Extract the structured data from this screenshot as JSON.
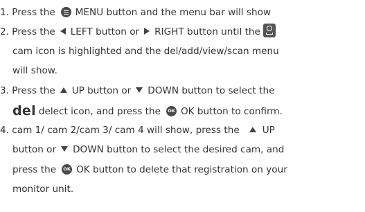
{
  "steps": [
    {
      "lines": [
        {
          "a": "1. Press the",
          "b": "MENU button and the menu bar will show"
        }
      ]
    },
    {
      "lines": [
        {
          "a": "2. Press the",
          "b": "LEFT button or",
          "c": "RIGHT button until the"
        },
        {
          "a": "cam  icon is highlighted and the del/add/view/scan menu"
        },
        {
          "a": "will show."
        }
      ]
    },
    {
      "lines": [
        {
          "a": "3. Press the",
          "b": "UP button or",
          "c": "DOWN button to select the"
        },
        {
          "del": "del",
          "a": "delect  icon, and press the",
          "b": "OK button to confirm."
        }
      ]
    },
    {
      "lines": [
        {
          "a": "4. cam 1/ cam 2/cam 3/ cam 4 will show, press the",
          "b": "UP"
        },
        {
          "a": "button or",
          "b": "DOWN button to select the desired cam, and"
        },
        {
          "a": "press the",
          "b": "OK button to delete that registration on your"
        },
        {
          "a": "monitor unit."
        }
      ]
    }
  ],
  "icons": {
    "menu": "menu-icon",
    "left": "left-arrow-icon",
    "right": "right-arrow-icon",
    "up": "up-arrow-icon",
    "down": "down-arrow-icon",
    "ok": "ok-icon",
    "ok_text": "OK",
    "cam": "camera-icon"
  }
}
